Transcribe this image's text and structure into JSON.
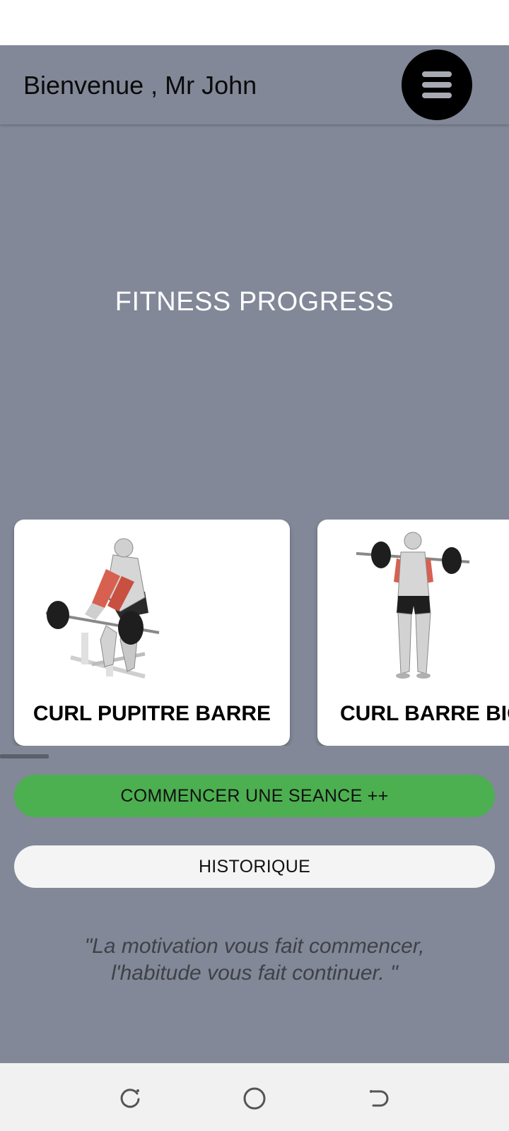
{
  "header": {
    "greeting": "Bienvenue , Mr John",
    "menu_icon": "hamburger-menu-icon"
  },
  "app_title": "FITNESS PROGRESS",
  "exercises": [
    {
      "name": "CURL PUPITRE BARRE",
      "image_icon": "preacher-curl-illustration"
    },
    {
      "name": "CURL BARRE BIC",
      "image_icon": "standing-barbell-curl-illustration"
    }
  ],
  "actions": {
    "start_session": "COMMENCER UNE SEANCE ++",
    "history": "HISTORIQUE"
  },
  "quote": {
    "line1": "\"La motivation vous fait commencer,",
    "line2": "l'habitude vous fait continuer. \""
  },
  "nav_bar": {
    "icons": [
      "recent-apps-icon",
      "home-icon",
      "back-icon"
    ]
  },
  "colors": {
    "background": "#828898",
    "start_button": "#4caf50",
    "history_button": "#f4f4f4",
    "menu_button": "#000000"
  }
}
